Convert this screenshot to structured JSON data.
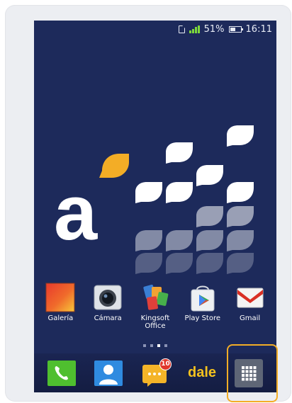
{
  "status_bar": {
    "battery_percent": "51%",
    "time": "16:11",
    "battery_level": 0.51,
    "colors": {
      "signal": "#7dd83b",
      "text": "#e8ecf5"
    }
  },
  "wallpaper": {
    "logo_letter": "a",
    "colors": {
      "background": "#1d2a5b",
      "accent": "#f3ad26"
    }
  },
  "apps": [
    {
      "name": "Galería",
      "icon": "gallery-icon"
    },
    {
      "name": "Cámara",
      "icon": "camera-icon"
    },
    {
      "name": "Kingsoft Office",
      "icon": "kingsoft-office-icon"
    },
    {
      "name": "Play Store",
      "icon": "play-store-icon"
    },
    {
      "name": "Gmail",
      "icon": "gmail-icon"
    }
  ],
  "page_indicator": {
    "pages": 4,
    "current": 3
  },
  "dock": {
    "phone_icon": "phone-icon",
    "contacts_icon": "contacts-icon",
    "messaging_icon": "messaging-icon",
    "messaging_badge": "10",
    "dale_label": "dale",
    "app_drawer_icon": "app-drawer-icon"
  }
}
